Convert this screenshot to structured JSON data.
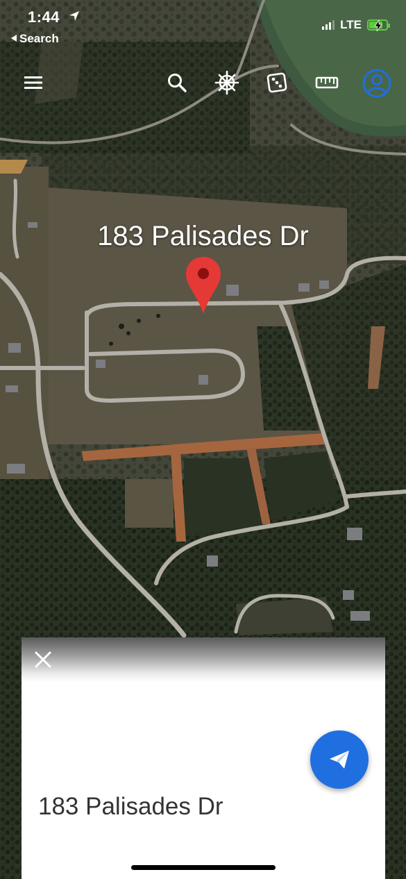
{
  "status_bar": {
    "time": "1:44",
    "back_label": "Search",
    "network": "LTE",
    "signal_bars": 3,
    "signal_max": 4,
    "battery_level": 0.8,
    "battery_color": "#5ecb3f"
  },
  "toolbar": {
    "buttons": [
      {
        "name": "menu-icon"
      },
      {
        "name": "search-icon"
      },
      {
        "name": "voyager-wheel-icon"
      },
      {
        "name": "feeling-lucky-dice-icon"
      },
      {
        "name": "measure-ruler-icon"
      },
      {
        "name": "account-icon"
      }
    ]
  },
  "map": {
    "place_label": "183 Palisades Dr",
    "pin_color": "#e53935"
  },
  "card": {
    "title": "183 Palisades Dr",
    "fab_color": "#1f6fe0"
  }
}
